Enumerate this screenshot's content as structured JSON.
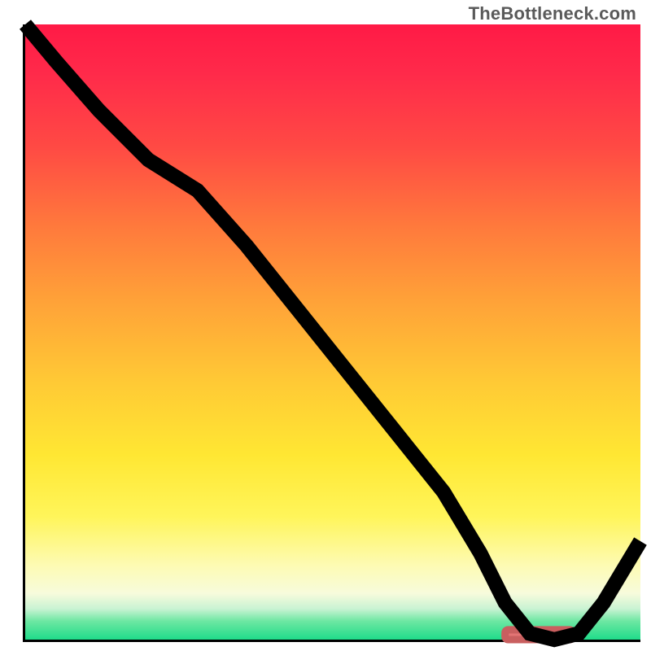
{
  "watermark": "TheBottleneck.com",
  "colors": {
    "gradient_top": "#ff1a46",
    "gradient_mid": "#ffc935",
    "gradient_bottom": "#1fdc8a",
    "curve": "#000000",
    "feature_bar": "#e37474",
    "axes": "#000000"
  },
  "chart_data": {
    "type": "line",
    "title": "",
    "xlabel": "",
    "ylabel": "",
    "xlim": [
      0,
      100
    ],
    "ylim": [
      0,
      100
    ],
    "grid": false,
    "series": [
      {
        "name": "curve",
        "x": [
          0,
          5,
          12,
          20,
          28,
          36,
          44,
          52,
          60,
          68,
          74,
          78,
          82,
          86,
          90,
          94,
          100
        ],
        "y": [
          100,
          94,
          86,
          78,
          73,
          64,
          54,
          44,
          34,
          24,
          14,
          6,
          1,
          0,
          1,
          6,
          16
        ]
      }
    ],
    "feature": {
      "name": "highlight-bar",
      "x_start": 78,
      "x_end": 89,
      "y": 0,
      "height": 1.6
    }
  }
}
